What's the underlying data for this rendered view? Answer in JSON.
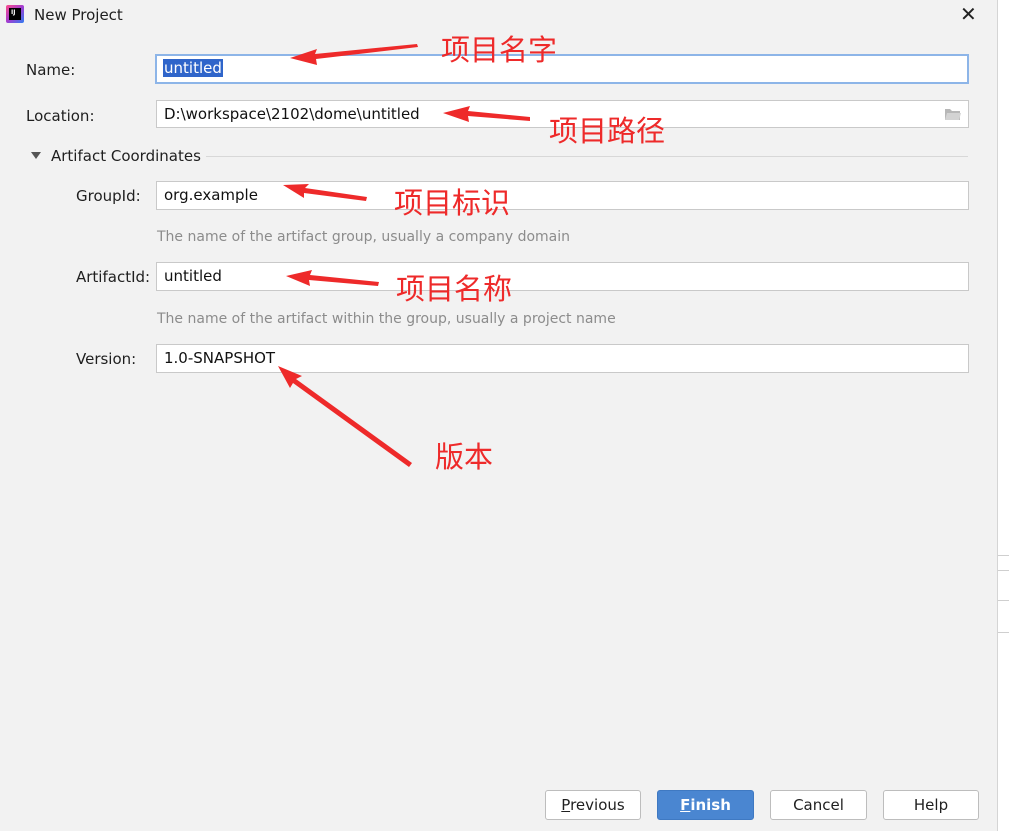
{
  "window": {
    "title": "New Project",
    "close_glyph": "✕",
    "app_icon_text": "IJ"
  },
  "form": {
    "name": {
      "label": "Name:",
      "value": "untitled"
    },
    "location": {
      "label": "Location:",
      "value": "D:\\workspace\\2102\\dome\\untitled"
    },
    "section": {
      "label": "Artifact Coordinates",
      "expanded": true
    },
    "group_id": {
      "label": "GroupId:",
      "value": "org.example",
      "hint": "The name of the artifact group, usually a company domain"
    },
    "artifact_id": {
      "label": "ArtifactId:",
      "value": "untitled",
      "hint": "The name of the artifact within the group, usually a project name"
    },
    "version": {
      "label": "Version:",
      "value": "1.0-SNAPSHOT"
    }
  },
  "annotations": {
    "name": "项目名字",
    "location": "项目路径",
    "group_id": "项目标识",
    "artifact_id": "项目名称",
    "version": "版本",
    "color": "#ee2a2a"
  },
  "buttons": {
    "previous": {
      "mnemonic": "P",
      "rest": "revious"
    },
    "finish": {
      "mnemonic": "F",
      "rest": "inish"
    },
    "cancel": "Cancel",
    "help": "Help"
  },
  "colors": {
    "primary": "#4a86d1",
    "selection": "#2f65ca",
    "focus_border": "#8db5e8",
    "annotation": "#ee2a2a"
  }
}
